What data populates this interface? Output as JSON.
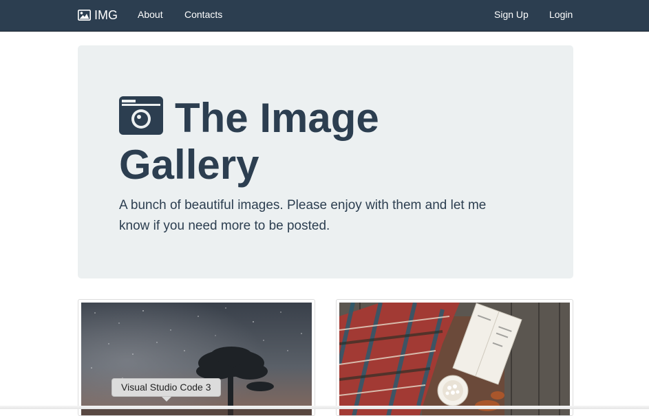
{
  "navbar": {
    "brand_label": "IMG",
    "brand_icon": "image-icon",
    "links": [
      "About",
      "Contacts"
    ],
    "right_links": [
      "Sign Up",
      "Login"
    ],
    "background": "#2c3e50"
  },
  "hero": {
    "icon": "camera-icon",
    "title": "The Image Gallery",
    "text": "A bunch of beautiful images. Please enjoy with them and let me know if you need more to be posted.",
    "background": "#ecf0f1",
    "text_color": "#2c3e50"
  },
  "cards": [
    {
      "name": "night-sky-tree-photo"
    },
    {
      "name": "plaid-blanket-book-cocoa-photo"
    }
  ],
  "tooltip": {
    "text": "Visual Studio Code 3"
  }
}
